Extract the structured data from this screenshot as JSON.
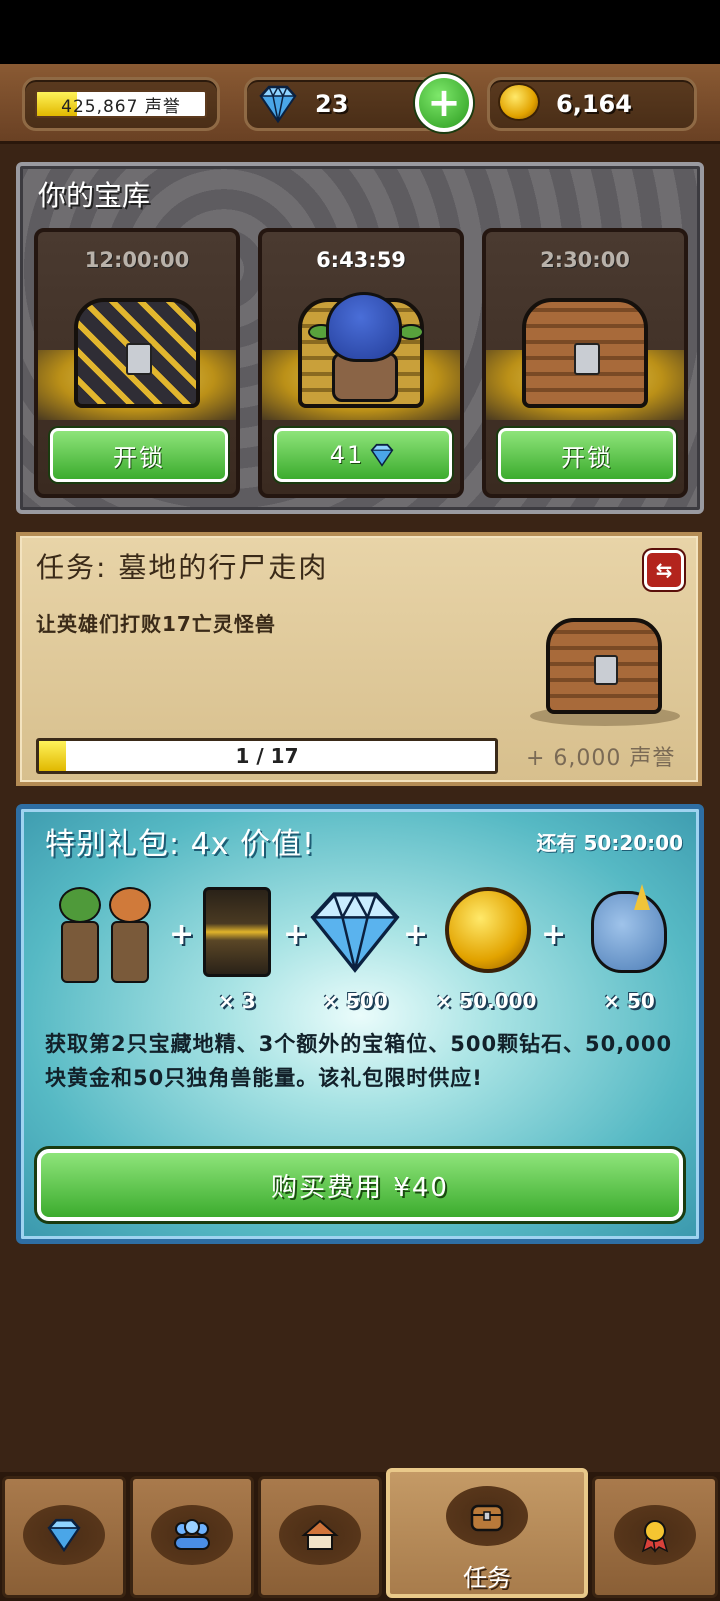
{
  "top_bar": {
    "reputation": "425,867 声誉",
    "reputation_progress": 0.24,
    "gems": "23",
    "add_gems_label": "+",
    "gold": "6,164"
  },
  "vault": {
    "title": "你的宝库",
    "slots": [
      {
        "timer": "12:00:00",
        "chest": "golden-chest",
        "button": "开锁",
        "active": false
      },
      {
        "timer": "6:43:59",
        "chest": "goblin-in-chest",
        "button": "41",
        "button_icon": "diamond-icon",
        "active": true
      },
      {
        "timer": "2:30:00",
        "chest": "wooden-chest",
        "button": "开锁",
        "active": false
      }
    ]
  },
  "quest": {
    "title": "任务: 墓地的行尸走肉",
    "description": "让英雄们打败17亡灵怪兽",
    "progress_text": "1 / 17",
    "progress_current": 1,
    "progress_total": 17,
    "reward": "+ 6,000 声誉",
    "reward_icon": "wooden-chest-icon"
  },
  "offer": {
    "title": "特别礼包: 4x 价值!",
    "timer": "还有 50:20:00",
    "items": [
      {
        "name": "treasure-goblins",
        "caption": ""
      },
      {
        "name": "chest-slot-card",
        "caption": "× 3"
      },
      {
        "name": "diamond",
        "caption": "× 500"
      },
      {
        "name": "gold-coin",
        "caption": "× 50.000"
      },
      {
        "name": "unicorn",
        "caption": "× 50"
      }
    ],
    "plus_sign": "+",
    "description": "获取第2只宝藏地精、3个额外的宝箱位、500颗钻石、50,000块黄金和50只独角兽能量。该礼包限时供应!",
    "buy_label": "购买费用 ¥40"
  },
  "nav": {
    "items": [
      {
        "icon": "diamond-icon",
        "label": ""
      },
      {
        "icon": "heroes-icon",
        "label": ""
      },
      {
        "icon": "town-icon",
        "label": ""
      },
      {
        "icon": "chest-icon",
        "label": "任务",
        "active": true
      },
      {
        "icon": "medal-icon",
        "label": ""
      }
    ]
  },
  "colors": {
    "button_green": "#3cac2e",
    "progress_yellow": "#f2d11a",
    "offer_border": "#2e6ea3",
    "quest_paper": "#e8d4a8"
  }
}
